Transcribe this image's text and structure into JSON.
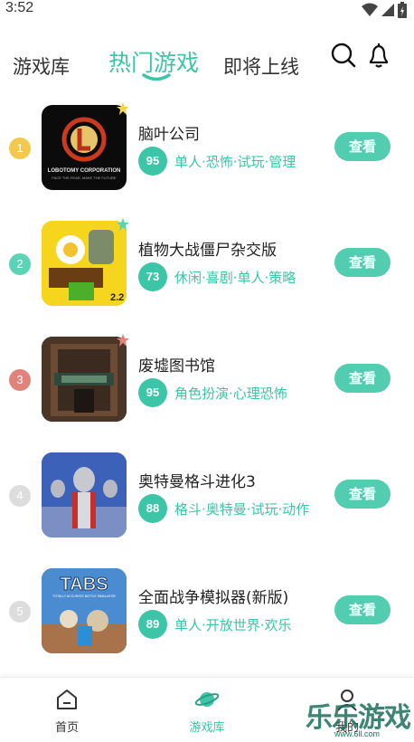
{
  "status_bar": {
    "time": "3:52"
  },
  "tabs": {
    "library": "游戏库",
    "hot": "热门游戏",
    "upcoming": "即将上线"
  },
  "games": [
    {
      "rank": "1",
      "title": "脑叶公司",
      "score": "95",
      "tags": "单人·恐怖·试玩·管理",
      "rank_color": "#f2c94c",
      "view_label": "查看"
    },
    {
      "rank": "2",
      "title": "植物大战僵尸杂交版",
      "score": "73",
      "tags": "休闲·喜剧·单人·策略",
      "rank_color": "#5dd3b6",
      "view_label": "查看"
    },
    {
      "rank": "3",
      "title": "废墟图书馆",
      "score": "95",
      "tags": "角色扮演·心理恐怖",
      "rank_color": "#e0837a",
      "view_label": "查看"
    },
    {
      "rank": "4",
      "title": "奥特曼格斗进化3",
      "score": "88",
      "tags": "格斗·奥特曼·试玩·动作",
      "rank_color": "#dddddd",
      "view_label": "查看"
    },
    {
      "rank": "5",
      "title": "全面战争模拟器(新版)",
      "score": "89",
      "tags": "单人·开放世界·欢乐",
      "rank_color": "#dddddd",
      "view_label": "查看"
    }
  ],
  "icon_texts": {
    "lobotomy_line1": "LOBOTOMY CORPORATION",
    "lobotomy_line2": "FACE THE FEAR, MAKE THE FUTURE",
    "pvz_version": "2.2",
    "tabs_logo": "TABS",
    "tabs_sub": "TOTALLY ACCURATE BATTLE SIMULATOR"
  },
  "bottom_nav": {
    "home": "首页",
    "games": "游戏库",
    "mine": "我的"
  },
  "watermark": {
    "text": "乐乐游戏",
    "url": "www.6ll.com"
  },
  "colors": {
    "accent": "#3cc5a7",
    "button": "#52cdb0"
  }
}
